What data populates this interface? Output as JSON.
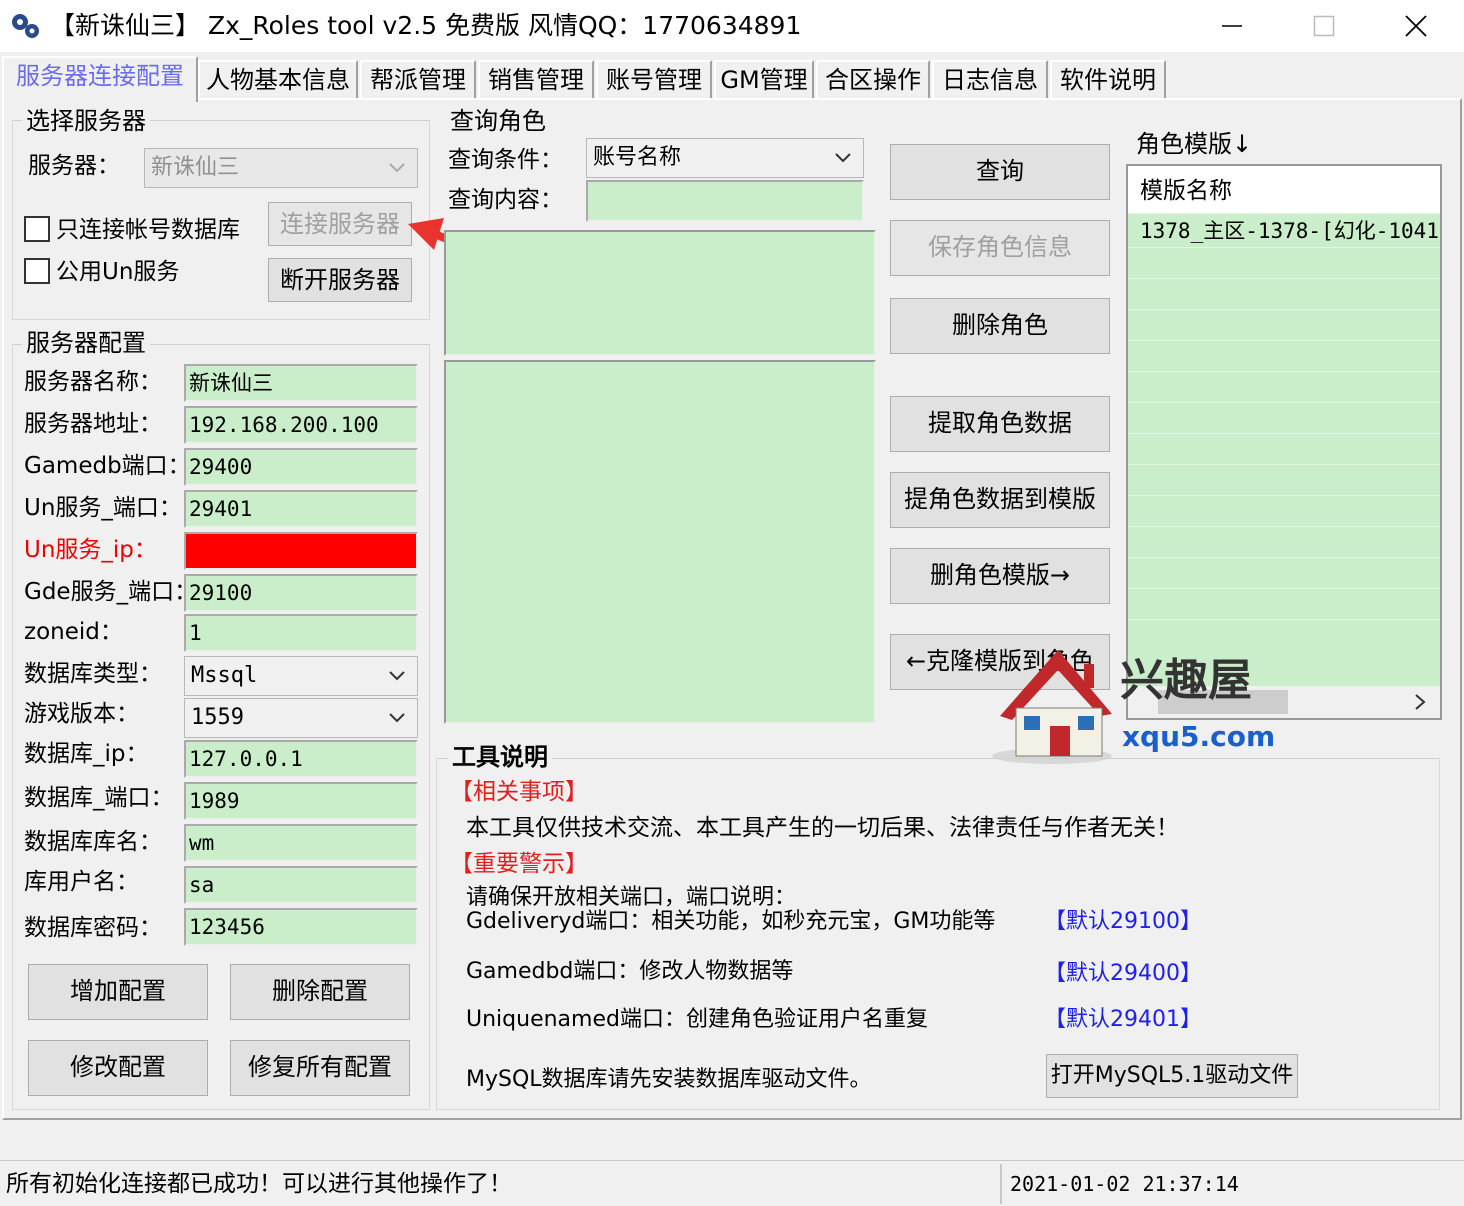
{
  "window": {
    "title": "【新诛仙三】 Zx_Roles tool v2.5 免费版 风情QQ：1770634891"
  },
  "tabs": [
    {
      "label": "服务器连接配置",
      "active": true
    },
    {
      "label": "人物基本信息"
    },
    {
      "label": "帮派管理"
    },
    {
      "label": "销售管理"
    },
    {
      "label": "账号管理"
    },
    {
      "label": "GM管理"
    },
    {
      "label": "合区操作"
    },
    {
      "label": "日志信息"
    },
    {
      "label": "软件说明"
    }
  ],
  "select_server": {
    "title": "选择服务器",
    "server_label": "服务器：",
    "server_value": "新诛仙三",
    "only_account_db_label": "只连接帐号数据库",
    "public_un_label": "公用Un服务",
    "connect_button": "连接服务器",
    "disconnect_button": "断开服务器"
  },
  "server_config": {
    "title": "服务器配置",
    "fields": [
      {
        "label": "服务器名称：",
        "value": "新诛仙三"
      },
      {
        "label": "服务器地址：",
        "value": "192.168.200.100"
      },
      {
        "label": "Gamedb端口：",
        "value": "29400"
      },
      {
        "label": "Un服务_端口：",
        "value": "29401"
      },
      {
        "label": "Un服务_ip：",
        "value": ""
      },
      {
        "label": "Gde服务_端口：",
        "value": "29100"
      },
      {
        "label": "zoneid：",
        "value": "1"
      },
      {
        "label": "数据库类型：",
        "value": "Mssql"
      },
      {
        "label": "游戏版本：",
        "value": "1559"
      },
      {
        "label": "数据库_ip：",
        "value": "127.0.0.1"
      },
      {
        "label": "数据库_端口：",
        "value": "1989"
      },
      {
        "label": "数据库库名：",
        "value": "wm"
      },
      {
        "label": "库用户名：",
        "value": "sa"
      },
      {
        "label": "数据库密码：",
        "value": "123456"
      }
    ],
    "add_button": "增加配置",
    "delete_button": "删除配置",
    "modify_button": "修改配置",
    "repair_button": "修复所有配置"
  },
  "query": {
    "title": "查询角色",
    "condition_label": "查询条件：",
    "condition_value": "账号名称",
    "content_label": "查询内容：",
    "content_value": ""
  },
  "actions": {
    "query": "查询",
    "save_role": "保存角色信息",
    "delete_role": "删除角色",
    "extract_role": "提取角色数据",
    "extract_to_template": "提角色数据到模版",
    "delete_template": "删角色模版→",
    "clone_template": "←克隆模版到角色"
  },
  "templates": {
    "title": "角色模版↓",
    "header": "模版名称",
    "rows": [
      "1378_主区-1378-[幻化-1041"
    ]
  },
  "tool_info": {
    "title": "工具说明",
    "notice_heading": "【相关事项】",
    "notice_text": "本工具仅供技术交流、本工具产生的一切后果、法律责任与作者无关！",
    "warning_heading": "【重要警示】",
    "ports_intro": "请确保开放相关端口，端口说明：",
    "gdelivery": "Gdeliveryd端口：相关功能，如秒充元宝，GM功能等",
    "gdelivery_default": "【默认29100】",
    "gamedb": "Gamedbd端口：修改人物数据等",
    "gamedb_default": "【默认29400】",
    "unique": "Uniquenamed端口：创建角色验证用户名重复",
    "unique_default": "【默认29401】",
    "mysql_text": "MySQL数据库请先安装数据库驱动文件。",
    "mysql_button": "打开MySQL5.1驱动文件"
  },
  "watermark": {
    "brand": "兴趣屋",
    "site": "xqu5.com"
  },
  "status": {
    "message": "所有初始化连接都已成功！可以进行其他操作了！",
    "datetime": "2021-01-02 21:37:14"
  },
  "colors": {
    "field_bg": "#c9eec9",
    "active_tab": "#6b6bf0",
    "warning_red": "#e31e1e",
    "ip_field_red": "#ff0000",
    "link_blue": "#2020ee",
    "arrow_red": "#e8332f"
  }
}
